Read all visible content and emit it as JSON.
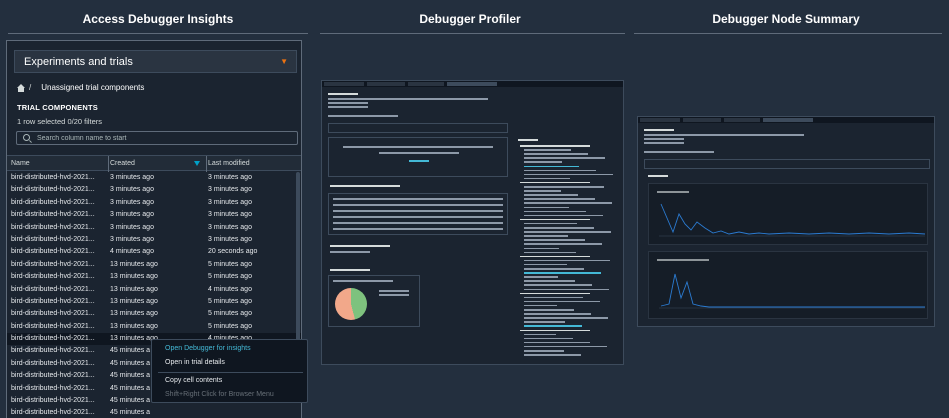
{
  "headings": [
    "Access Debugger Insights",
    "Debugger Profiler",
    "Debugger Node Summary"
  ],
  "panel1": {
    "dropdown_label": "Experiments and trials",
    "breadcrumb_sep": "/",
    "breadcrumb_label": "Unassigned trial components",
    "section_title": "TRIAL COMPONENTS",
    "selection_summary": "1 row selected   0/20 filters",
    "search_placeholder": "Search column name to start",
    "columns": [
      "Name",
      "Created",
      "Last modified"
    ],
    "rows": [
      [
        "bird-distributed-hvd-2021...",
        "3 minutes ago",
        "3 minutes ago"
      ],
      [
        "bird-distributed-hvd-2021...",
        "3 minutes ago",
        "3 minutes ago"
      ],
      [
        "bird-distributed-hvd-2021...",
        "3 minutes ago",
        "3 minutes ago"
      ],
      [
        "bird-distributed-hvd-2021...",
        "3 minutes ago",
        "3 minutes ago"
      ],
      [
        "bird-distributed-hvd-2021...",
        "3 minutes ago",
        "3 minutes ago"
      ],
      [
        "bird-distributed-hvd-2021...",
        "3 minutes ago",
        "3 minutes ago"
      ],
      [
        "bird-distributed-hvd-2021...",
        "4 minutes ago",
        "20 seconds ago"
      ],
      [
        "bird-distributed-hvd-2021...",
        "13 minutes ago",
        "5 minutes ago"
      ],
      [
        "bird-distributed-hvd-2021...",
        "13 minutes ago",
        "5 minutes ago"
      ],
      [
        "bird-distributed-hvd-2021...",
        "13 minutes ago",
        "4 minutes ago"
      ],
      [
        "bird-distributed-hvd-2021...",
        "13 minutes ago",
        "5 minutes ago"
      ],
      [
        "bird-distributed-hvd-2021...",
        "13 minutes ago",
        "5 minutes ago"
      ],
      [
        "bird-distributed-hvd-2021...",
        "13 minutes ago",
        "5 minutes ago"
      ],
      [
        "bird-distributed-hvd-2021...",
        "13 minutes ago",
        "4 minutes ago"
      ],
      [
        "bird-distributed-hvd-2021...",
        "45 minutes a",
        ""
      ],
      [
        "bird-distributed-hvd-2021...",
        "45 minutes a",
        ""
      ],
      [
        "bird-distributed-hvd-2021...",
        "45 minutes a",
        ""
      ],
      [
        "bird-distributed-hvd-2021...",
        "45 minutes a",
        ""
      ],
      [
        "bird-distributed-hvd-2021...",
        "45 minutes a",
        ""
      ],
      [
        "bird-distributed-hvd-2021...",
        "45 minutes a",
        ""
      ]
    ],
    "selected_row": 13,
    "context_menu": [
      "Open Debugger for insights",
      "Open in trial details",
      "Copy cell contents",
      "Shift+Right Click for Browser Menu"
    ]
  },
  "colors": {
    "background": "#232f3e",
    "accent_orange": "#ec7211",
    "accent_cyan": "#44b9d6",
    "pie_green": "#7ec27e",
    "pie_salmon": "#f2a88a",
    "plot_line": "#2b7bd1"
  }
}
